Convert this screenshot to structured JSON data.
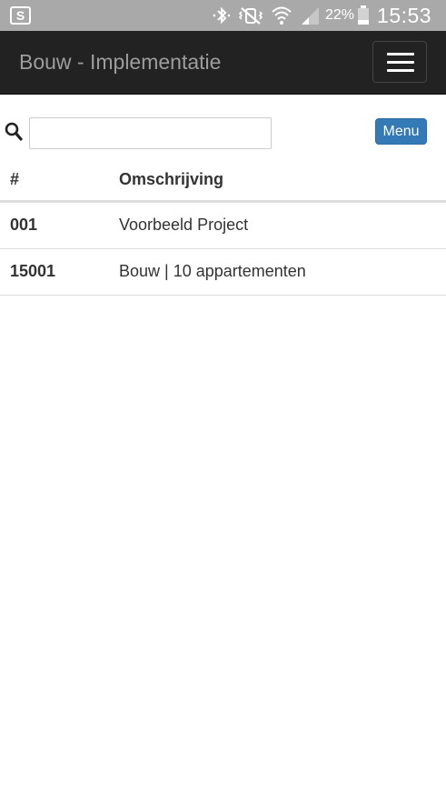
{
  "status_bar": {
    "app_icon_letter": "S",
    "battery_percent": "22%",
    "time": "15:53",
    "icons": [
      "bluetooth-icon",
      "vibrate-mute-icon",
      "wifi-icon",
      "cell-signal-icon",
      "battery-icon"
    ]
  },
  "navbar": {
    "brand": "Bouw - Implementatie",
    "toggle_icon": "hamburger-icon"
  },
  "toolbar": {
    "search_icon": "search-icon",
    "search_value": "",
    "search_placeholder": "",
    "menu_label": "Menu"
  },
  "table": {
    "headers": [
      "#",
      "Omschrijving"
    ],
    "rows": [
      {
        "number": "001",
        "description": "Voorbeeld Project"
      },
      {
        "number": "15001",
        "description": "Bouw | 10 appartementen"
      }
    ]
  },
  "colors": {
    "status_bar_bg": "#a9a9a9",
    "navbar_bg": "#222222",
    "brand_text": "#9d9d9d",
    "primary_button": "#337ab7",
    "table_border": "#dddddd",
    "text": "#333333"
  }
}
